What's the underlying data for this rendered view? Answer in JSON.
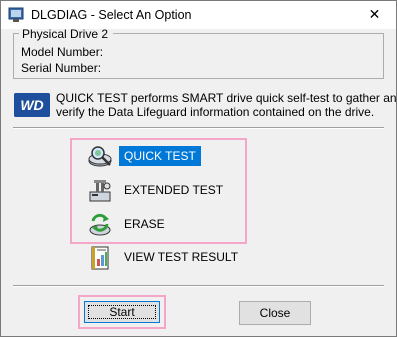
{
  "window": {
    "title": "DLGDIAG - Select An Option",
    "close_glyph": "✕"
  },
  "drive_info": {
    "legend": "Physical Drive 2",
    "model_label": "Model Number:",
    "serial_label": "Serial Number:"
  },
  "logo": {
    "text": "WD",
    "color": "#1f4f9c"
  },
  "description": {
    "line1": "QUICK TEST performs SMART drive quick self-test to gather and",
    "line2": "verify the Data Lifeguard information contained on the drive."
  },
  "options": [
    {
      "label": "QUICK TEST",
      "icon": "magnifier-disk-icon",
      "selected": true
    },
    {
      "label": "EXTENDED TEST",
      "icon": "disk-tools-icon",
      "selected": false
    },
    {
      "label": "ERASE",
      "icon": "recycle-disk-icon",
      "selected": false
    },
    {
      "label": "VIEW TEST RESULT",
      "icon": "report-chart-icon",
      "selected": false
    }
  ],
  "buttons": {
    "start": "Start",
    "close": "Close"
  },
  "colors": {
    "selection": "#0078d7",
    "highlight_annotation": "#f4a6c8"
  }
}
